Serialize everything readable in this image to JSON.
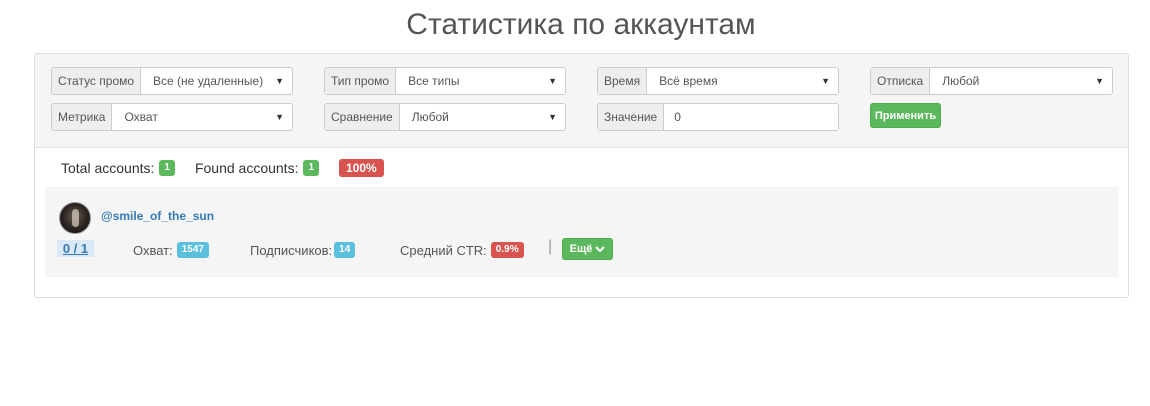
{
  "page_title": "Статистика по аккаунтам",
  "filters": {
    "status_promo": {
      "label": "Статус промо",
      "value": "Все (не удаленные)"
    },
    "promo_type": {
      "label": "Тип промо",
      "value": "Все типы"
    },
    "time": {
      "label": "Время",
      "value": "Всё время"
    },
    "unsubscribe": {
      "label": "Отписка",
      "value": "Любой"
    },
    "metric": {
      "label": "Метрика",
      "value": "Охват"
    },
    "comparison": {
      "label": "Сравнение",
      "value": "Любой"
    },
    "value": {
      "label": "Значение",
      "value": "0"
    },
    "apply_label": "Применить"
  },
  "summary": {
    "total_label": "Total accounts:",
    "total_count": "1",
    "found_label": "Found accounts:",
    "found_count": "1",
    "percent": "100%"
  },
  "account": {
    "handle": "@smile_of_the_sun",
    "ratio": "0 / 1",
    "reach_label": "Охват:",
    "reach_value": "1547",
    "subs_label": "Подписчиков:",
    "subs_value": "14",
    "ctr_label": "Средний CTR:",
    "ctr_value": "0.9%",
    "more_label": "Ещё"
  },
  "colors": {
    "success": "#5cb85c",
    "danger": "#d9534f",
    "info": "#5bc0de",
    "link": "#337ab7"
  }
}
